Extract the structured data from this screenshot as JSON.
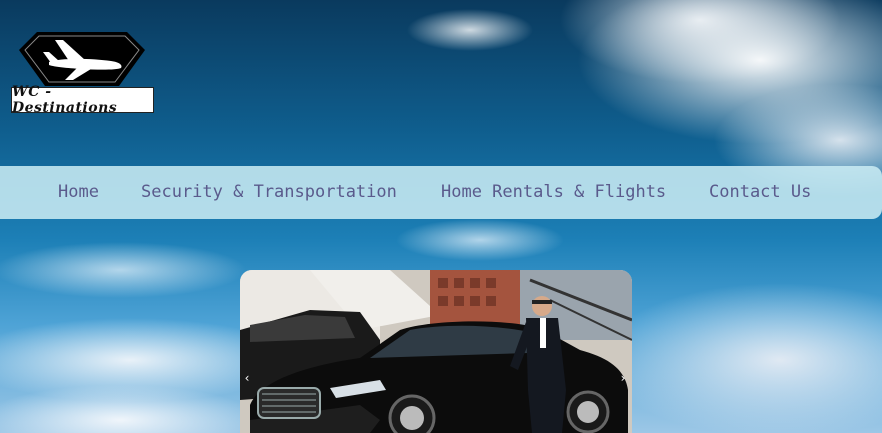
{
  "logo": {
    "text": "WC - Destinations"
  },
  "nav": {
    "items": [
      {
        "label": "Home"
      },
      {
        "label": "Security & Transportation"
      },
      {
        "label": "Home Rentals & Flights"
      },
      {
        "label": "Contact Us"
      }
    ]
  },
  "carousel": {
    "prev_icon": "chevron-left-icon",
    "next_icon": "chevron-right-icon",
    "prev_glyph": "‹",
    "next_glyph": "›",
    "image": "chauffeur-with-black-sedan"
  },
  "colors": {
    "nav_background": "#c8eaf2",
    "nav_text": "#5a5a8c",
    "logo_badge": "#000000"
  }
}
